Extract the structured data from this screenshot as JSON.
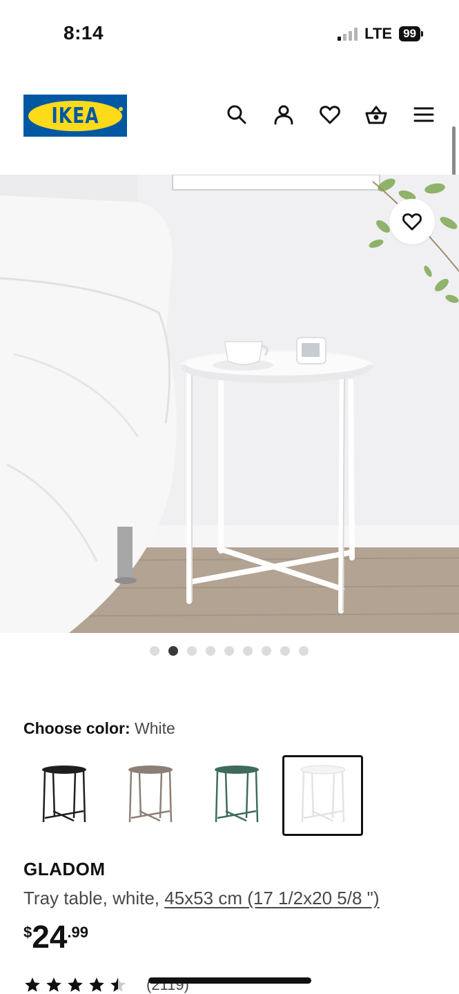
{
  "status_bar": {
    "time": "8:14",
    "network": "LTE",
    "battery": "99",
    "signal_bars_active": 1,
    "signal_bars_total": 4
  },
  "header": {
    "logo_text": "IKEA",
    "icons": [
      "search-icon",
      "account-icon",
      "heart-icon",
      "shopping-bag-icon",
      "menu-icon"
    ]
  },
  "gallery": {
    "image_count": 9,
    "active_index": 1,
    "image_alt": "GLADOM tray table, white"
  },
  "color_picker": {
    "label": "Choose color:",
    "selected_value": "White",
    "options": [
      {
        "name": "Black",
        "color": "#1e1e1e"
      },
      {
        "name": "Beige",
        "color": "#8c7f76"
      },
      {
        "name": "Green",
        "color": "#3f6b5c"
      },
      {
        "name": "White",
        "color": "#f2f2f2",
        "selected": true
      }
    ]
  },
  "product": {
    "name": "GLADOM",
    "description_prefix": "Tray table, white,",
    "dimensions": "45x53 cm (17 1/2x20 5/8 \")",
    "price_currency": "$",
    "price_integer": "24",
    "price_decimal": ".99"
  },
  "rating": {
    "stars": 4.5,
    "review_count": "(2119)"
  },
  "colors": {
    "ikea_blue": "#0058a3",
    "ikea_yellow": "#ffda1a",
    "text_primary": "#111111",
    "text_secondary": "#484848"
  }
}
